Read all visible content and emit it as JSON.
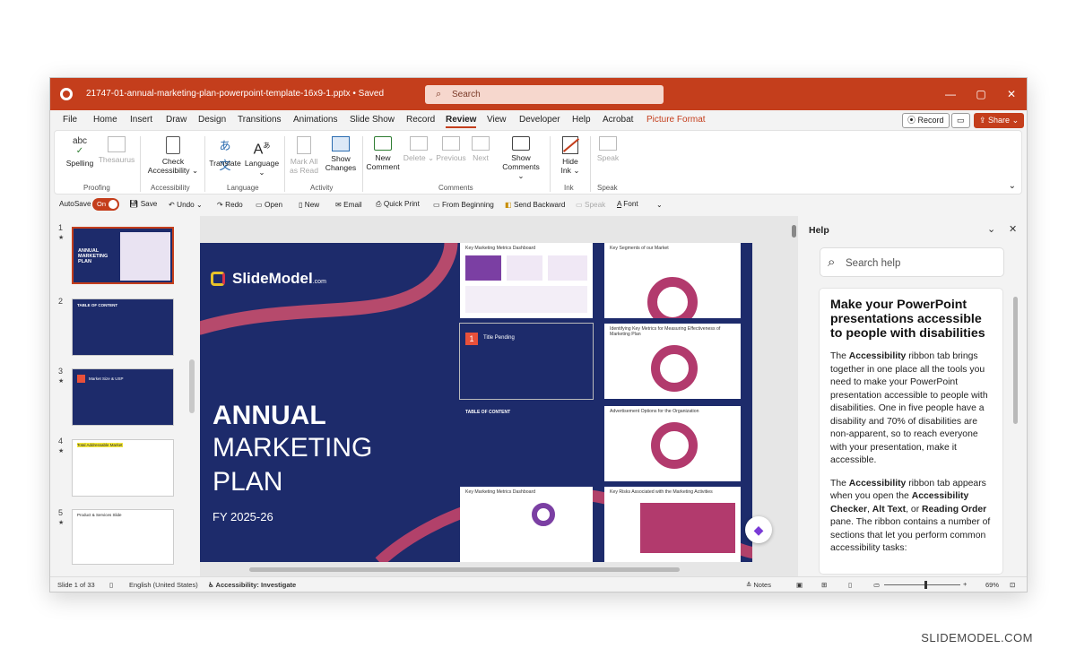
{
  "window": {
    "file_name": "21747-01-annual-marketing-plan-powerpoint-template-16x9-1.pptx • Saved",
    "search_placeholder": "Search",
    "controls": [
      "—",
      "▢",
      "✕"
    ]
  },
  "menu": {
    "tabs": [
      "File",
      "Home",
      "Insert",
      "Draw",
      "Design",
      "Transitions",
      "Animations",
      "Slide Show",
      "Record",
      "Review",
      "View",
      "Developer",
      "Help",
      "Acrobat",
      "Picture Format"
    ],
    "active": "Review",
    "record_label": "Record",
    "share_label": "Share"
  },
  "ribbon": {
    "spelling": "Spelling",
    "thesaurus": "Thesaurus",
    "check_acc_1": "Check",
    "check_acc_2": "Accessibility",
    "translate": "Translate",
    "language": "Language",
    "mark_all_1": "Mark All",
    "mark_all_2": "as Read",
    "show_changes_1": "Show",
    "show_changes_2": "Changes",
    "new_comment_1": "New",
    "new_comment_2": "Comment",
    "delete": "Delete",
    "previous": "Previous",
    "next": "Next",
    "show_comments_1": "Show",
    "show_comments_2": "Comments",
    "hide_ink_1": "Hide",
    "hide_ink_2": "Ink",
    "speak": "Speak",
    "groups": {
      "proofing": "Proofing",
      "accessibility": "Accessibility",
      "language": "Language",
      "activity": "Activity",
      "comments": "Comments",
      "ink": "Ink",
      "speak": "Speak"
    }
  },
  "qat": {
    "autosave": "AutoSave",
    "toggle": "On",
    "save": "Save",
    "undo": "Undo",
    "redo": "Redo",
    "open": "Open",
    "new": "New",
    "email": "Email",
    "quick_print": "Quick Print",
    "from_beginning": "From Beginning",
    "send_backward": "Send Backward",
    "speak": "Speak",
    "font": "Font"
  },
  "thumbnails": [
    {
      "num": "1",
      "star": "★",
      "title": "ANNUAL MARKETING PLAN"
    },
    {
      "num": "2",
      "star": "",
      "title": "TABLE OF CONTENT"
    },
    {
      "num": "3",
      "star": "★",
      "title": "Market Size & USP"
    },
    {
      "num": "4",
      "star": "★",
      "title": "Total Addressable Market"
    },
    {
      "num": "5",
      "star": "★",
      "title": "Product & Services Slide"
    }
  ],
  "slide": {
    "brand": "SlideModel",
    "brand_suffix": ".com",
    "title_line1": "ANNUAL",
    "title_line2": "MARKETING",
    "title_line3": "PLAN",
    "subtitle": "FY 2025-26",
    "cards": {
      "c1": "Key Marketing Metrics Dashboard",
      "c2": "Key Segments of our Market",
      "c3": "Title Pending",
      "c3_num": "1",
      "c4": "Identifying Key Metrics for Measuring Effectiveness of Marketing Plan",
      "c5": "TABLE OF CONTENT",
      "c6": "Advertisement Options for the Organization",
      "c7": "Key Marketing Metrics Dashboard",
      "c8": "Key Risks Associated with the Marketing Activities"
    }
  },
  "help": {
    "title": "Help",
    "search_placeholder": "Search help",
    "article_title": "Make your PowerPoint presentations accessible to people with disabilities",
    "p1_bold": "Accessibility",
    "p1_a": "The ",
    "p1_b": " ribbon tab brings together in one place all the tools you need to make your PowerPoint presentation accessible to people with disabilities. One in five people have a disability and 70% of disabilities are non-apparent, so to reach everyone with your presentation, make it accessible.",
    "p2_a": "The ",
    "p2_bold1": "Accessibility",
    "p2_b": " ribbon tab appears when you open the ",
    "p2_bold2": "Accessibility Checker",
    "p2_c": ", ",
    "p2_bold3": "Alt Text",
    "p2_d": ", or ",
    "p2_bold4": "Reading Order",
    "p2_e": " pane. The ribbon contains a number of sections that let you perform common accessibility tasks:"
  },
  "status": {
    "slide_count": "Slide 1 of 33",
    "language": "English (United States)",
    "accessibility": "Accessibility: Investigate",
    "notes": "Notes",
    "zoom": "69%"
  },
  "watermark": "SLIDEMODEL.COM",
  "colors": {
    "accent": "#c43e1c",
    "slide_bg": "#1d2b6b"
  }
}
